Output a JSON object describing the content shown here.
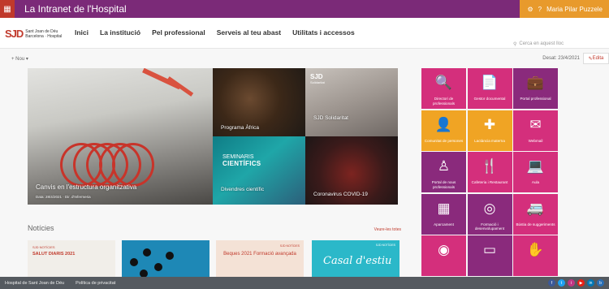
{
  "suitebar": {
    "title": "La Intranet de l'Hospital",
    "user": "Maria Pilar Puzzele"
  },
  "logo": {
    "mark": "SJD",
    "line1": "Sant Joan de Déu",
    "line2": "Barcelona · Hospital"
  },
  "nav": [
    "Inici",
    "La institució",
    "Pel professional",
    "Serveis al teu abast",
    "Utilitats i accessos"
  ],
  "search": {
    "placeholder": "Cerca en aquest lloc"
  },
  "cmdbar": {
    "menu": "Nou",
    "status": "Desat: 23/4/2021",
    "edit": "Edita"
  },
  "hero": {
    "main": {
      "caption": "Canvis en l'estructura organitzativa",
      "meta": "Data: 28/4/2021 · Dir. d'Infermeria"
    },
    "kids": {
      "caption": "Programa Àfrica"
    },
    "sjd": {
      "badge": "SJD",
      "badge_sub": "Solidaritat",
      "caption": "SJD Solidaritat"
    },
    "sci": {
      "word1": "SEMINARIS",
      "word2": "CIENTÍFICS",
      "caption": "Divendres científic"
    },
    "virus": {
      "caption": "Coronavirus COVID-19"
    }
  },
  "quicklaunch": [
    {
      "label": "Directori de professionals",
      "icon": "search-icon",
      "glyph": "🔍",
      "color": "#d42f7c"
    },
    {
      "label": "Gestor documental",
      "icon": "document-icon",
      "glyph": "📄",
      "color": "#d42f7c"
    },
    {
      "label": "Portal professional",
      "icon": "briefcase-icon",
      "glyph": "💼",
      "color": "#8a2a7c"
    },
    {
      "label": "Comunitat de persones",
      "icon": "people-icon",
      "glyph": "👤",
      "color": "#f0a424"
    },
    {
      "label": "Lactància materna",
      "icon": "add-circle-icon",
      "glyph": "✚",
      "color": "#f0a424"
    },
    {
      "label": "Webmail",
      "icon": "mail-icon",
      "glyph": "✉",
      "color": "#d42f7c"
    },
    {
      "label": "Portal de nous professionals",
      "icon": "user-tie-icon",
      "glyph": "♙",
      "color": "#8a2a7c"
    },
    {
      "label": "Cafeteria i Restaurant",
      "icon": "cutlery-icon",
      "glyph": "🍴",
      "color": "#d42f7c"
    },
    {
      "label": "Aula",
      "icon": "laptop-icon",
      "glyph": "💻",
      "color": "#d42f7c"
    },
    {
      "label": "Aparcament",
      "icon": "building-icon",
      "glyph": "▦",
      "color": "#8a2a7c"
    },
    {
      "label": "Formació i desenvolupament",
      "icon": "palette-icon",
      "glyph": "◎",
      "color": "#8a2a7c"
    },
    {
      "label": "Bústia de suggeriments",
      "icon": "van-icon",
      "glyph": "🚐",
      "color": "#d42f7c"
    },
    {
      "label": "",
      "icon": "circle-icon",
      "glyph": "◉",
      "color": "#d42f7c"
    },
    {
      "label": "",
      "icon": "screen-icon",
      "glyph": "▭",
      "color": "#8a2a7c"
    },
    {
      "label": "",
      "icon": "hand-icon",
      "glyph": "✋",
      "color": "#d42f7c"
    }
  ],
  "news": {
    "title": "Notícies",
    "more": "Veure-les totes",
    "cards": [
      {
        "kicker": "SJD NOTÍCIES",
        "headline": "SALUT DIARIS 2021"
      },
      {
        "kicker": "",
        "headline": ""
      },
      {
        "kicker": "SJD NOTÍCIES",
        "headline": "Beques 2021 Formació avançada"
      },
      {
        "kicker": "SJD NOTÍCIES",
        "headline": "Casal d'estiu"
      }
    ]
  },
  "footer": {
    "left": "Hospital de Sant Joan de Déu",
    "privacy": "Política de privacitat"
  },
  "socials": [
    {
      "name": "facebook-icon",
      "glyph": "f",
      "color": "#3b5998"
    },
    {
      "name": "twitter-icon",
      "glyph": "t",
      "color": "#1da1f2"
    },
    {
      "name": "instagram-icon",
      "glyph": "i",
      "color": "#c13584"
    },
    {
      "name": "youtube-icon",
      "glyph": "▶",
      "color": "#e62117"
    },
    {
      "name": "linkedin-icon",
      "glyph": "in",
      "color": "#0077b5"
    },
    {
      "name": "blog-icon",
      "glyph": "b",
      "color": "#2a6fb5"
    }
  ]
}
